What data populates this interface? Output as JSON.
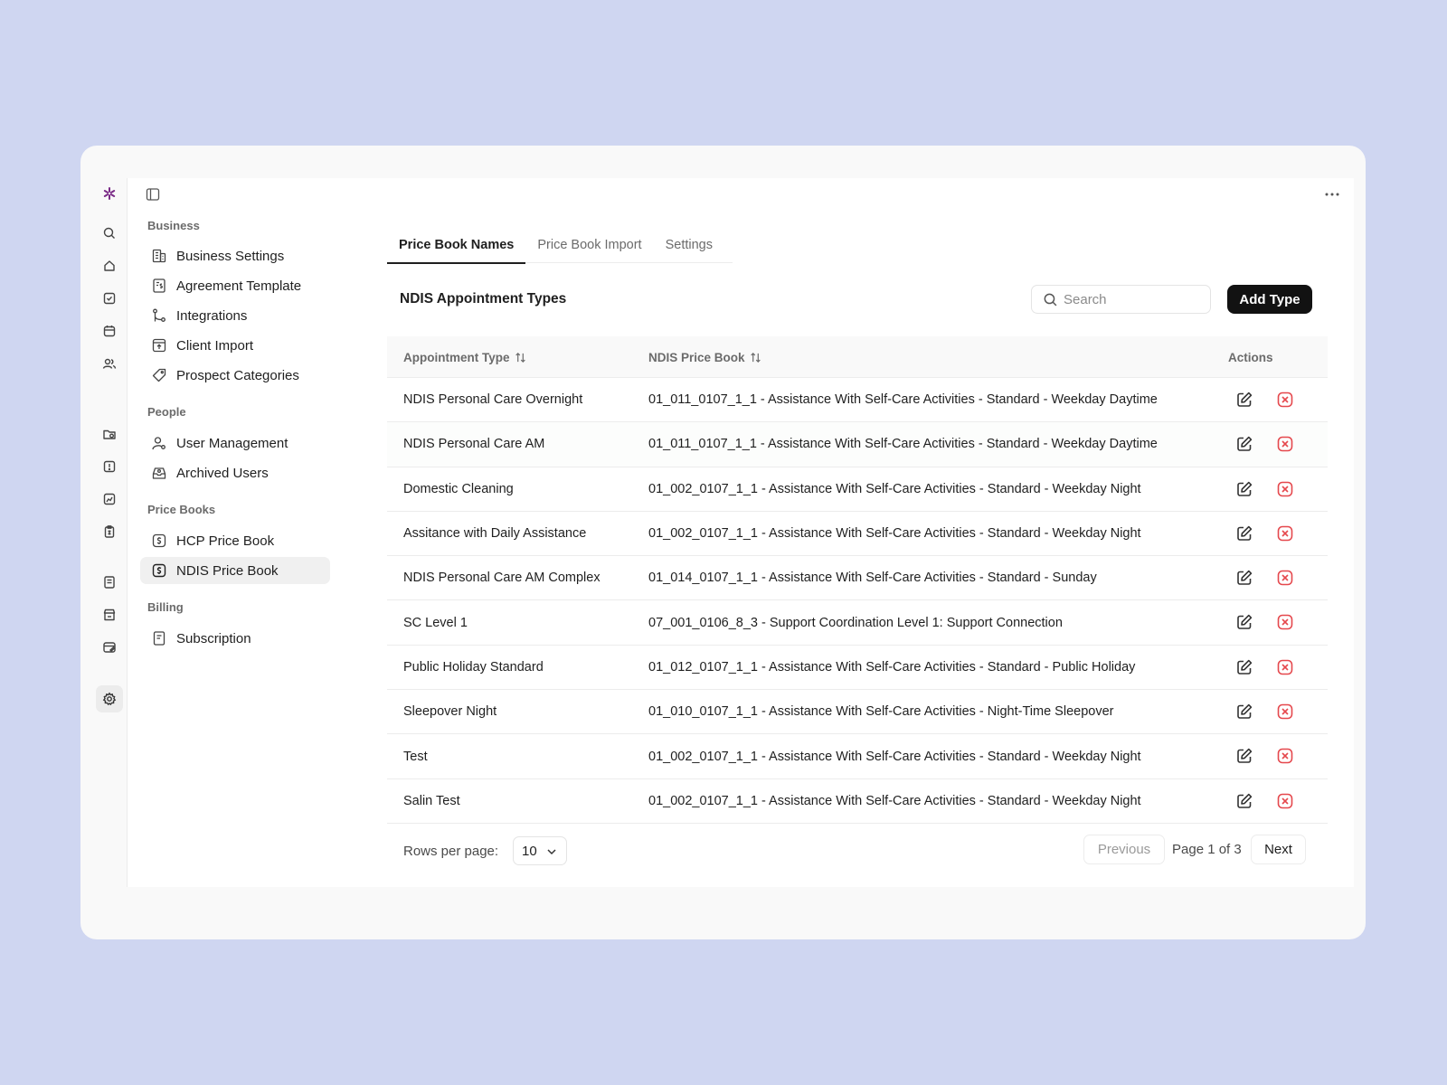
{
  "colors": {
    "background": "#cfd6f1",
    "brand": "#7a2a86",
    "danger": "#e5484d",
    "primary_button": "#121212"
  },
  "rail": {
    "icons": [
      "logo-icon",
      "search-icon",
      "home-icon",
      "tasks-icon",
      "calendar-icon",
      "users-icon",
      "folder-icon",
      "alert-icon",
      "reports-icon",
      "clipboard-icon",
      "invoice-icon",
      "store-icon",
      "billing-icon",
      "settings-icon"
    ]
  },
  "sidebar": {
    "sections": [
      {
        "title": "Business",
        "items": [
          "Business Settings",
          "Agreement Template",
          "Integrations",
          "Client Import",
          "Prospect Categories"
        ]
      },
      {
        "title": "People",
        "items": [
          "User Management",
          "Archived Users"
        ]
      },
      {
        "title": "Price Books",
        "items": [
          "HCP Price Book",
          "NDIS Price Book"
        ]
      },
      {
        "title": "Billing",
        "items": [
          "Subscription"
        ]
      }
    ],
    "active_item": "NDIS Price Book"
  },
  "tabs": [
    "Price Book Names",
    "Price Book Import",
    "Settings"
  ],
  "active_tab": "Price Book Names",
  "section": {
    "title": "NDIS Appointment Types",
    "search_placeholder": "Search",
    "add_label": "Add Type"
  },
  "table": {
    "headers": [
      "Appointment Type",
      "NDIS Price Book",
      "Actions"
    ],
    "rows": [
      {
        "type": "NDIS Personal Care Overnight",
        "price_book": "01_011_0107_1_1 - Assistance With Self-Care Activities - Standard - Weekday Daytime"
      },
      {
        "type": "NDIS Personal Care AM",
        "price_book": "01_011_0107_1_1 - Assistance With Self-Care Activities - Standard - Weekday Daytime"
      },
      {
        "type": "Domestic Cleaning",
        "price_book": "01_002_0107_1_1 - Assistance With Self-Care Activities - Standard - Weekday Night"
      },
      {
        "type": "Assitance with Daily Assistance",
        "price_book": "01_002_0107_1_1 - Assistance With Self-Care Activities - Standard - Weekday Night"
      },
      {
        "type": "NDIS Personal Care AM Complex",
        "price_book": "01_014_0107_1_1 - Assistance With Self-Care Activities - Standard - Sunday"
      },
      {
        "type": "SC Level 1",
        "price_book": "07_001_0106_8_3 - Support Coordination Level 1: Support Connection"
      },
      {
        "type": "Public Holiday Standard",
        "price_book": "01_012_0107_1_1 - Assistance With Self-Care Activities - Standard - Public Holiday"
      },
      {
        "type": "Sleepover Night",
        "price_book": "01_010_0107_1_1 - Assistance With Self-Care Activities - Night-Time Sleepover"
      },
      {
        "type": "Test",
        "price_book": "01_002_0107_1_1 - Assistance With Self-Care Activities - Standard - Weekday Night"
      },
      {
        "type": "Salin Test",
        "price_book": "01_002_0107_1_1 - Assistance With Self-Care Activities - Standard - Weekday Night"
      }
    ]
  },
  "pagination": {
    "rows_per_page_label": "Rows per page:",
    "rows_per_page": "10",
    "previous_label": "Previous",
    "page_info": "Page 1 of 3",
    "next_label": "Next"
  }
}
